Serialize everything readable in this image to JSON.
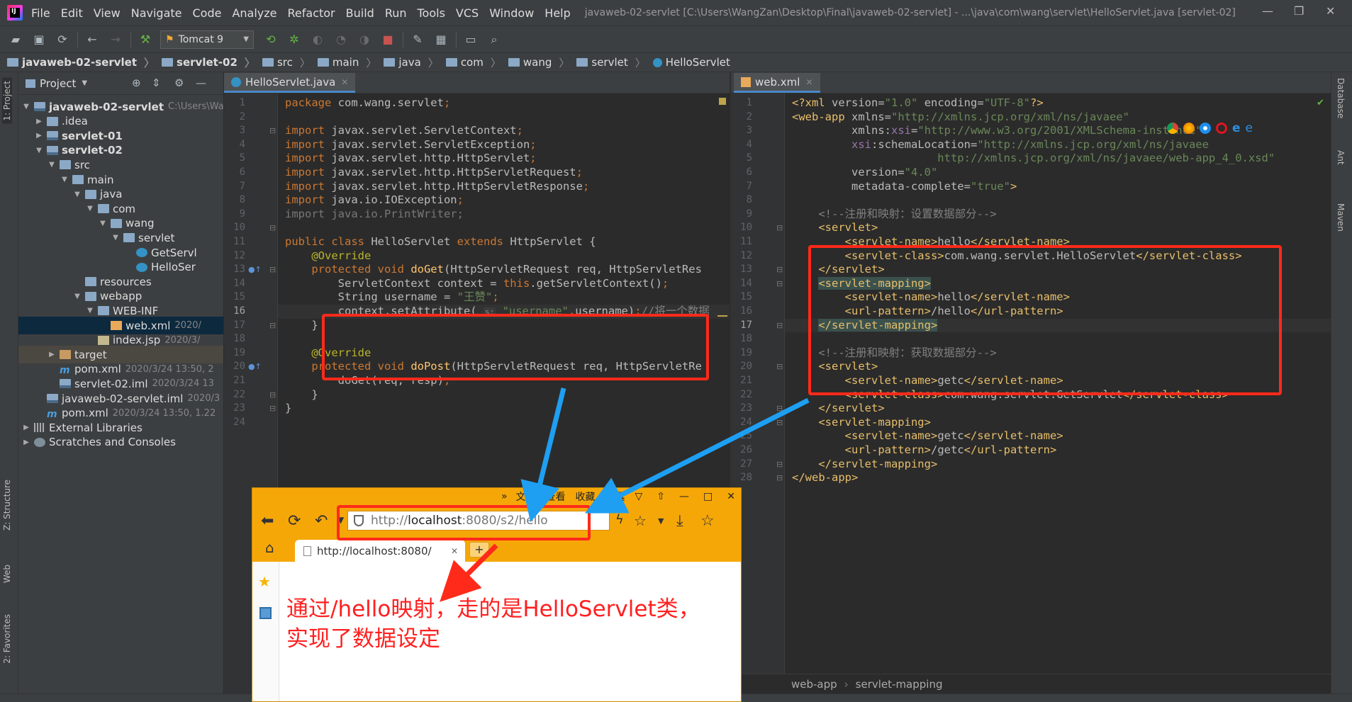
{
  "app": {
    "menu": [
      "File",
      "Edit",
      "View",
      "Navigate",
      "Code",
      "Analyze",
      "Refactor",
      "Build",
      "Run",
      "Tools",
      "VCS",
      "Window",
      "Help"
    ],
    "window_title": "javaweb-02-servlet [C:\\Users\\WangZan\\Desktop\\Final\\javaweb-02-servlet] - ...\\java\\com\\wang\\servlet\\HelloServlet.java [servlet-02]"
  },
  "toolbar": {
    "run_config": "Tomcat 9"
  },
  "breadcrumb": [
    "javaweb-02-servlet",
    "servlet-02",
    "src",
    "main",
    "java",
    "com",
    "wang",
    "servlet",
    "HelloServlet"
  ],
  "left_strip": {
    "project_tab": "1: Project",
    "structure_tab": "Z: Structure",
    "web_tab": "Web",
    "favorites_tab": "2: Favorites"
  },
  "project": {
    "title": "Project",
    "tree": [
      {
        "label": "javaweb-02-servlet",
        "meta": "C:\\Users\\Wa",
        "depth": 0,
        "arrow": "▼",
        "icon": "module",
        "bold": true
      },
      {
        "label": ".idea",
        "meta": "",
        "depth": 1,
        "arrow": "▶",
        "icon": "folder"
      },
      {
        "label": "servlet-01",
        "meta": "",
        "depth": 1,
        "arrow": "▶",
        "icon": "module",
        "bold": true
      },
      {
        "label": "servlet-02",
        "meta": "",
        "depth": 1,
        "arrow": "▼",
        "icon": "module",
        "bold": true
      },
      {
        "label": "src",
        "meta": "",
        "depth": 2,
        "arrow": "▼",
        "icon": "folder"
      },
      {
        "label": "main",
        "meta": "",
        "depth": 3,
        "arrow": "▼",
        "icon": "folder"
      },
      {
        "label": "java",
        "meta": "",
        "depth": 4,
        "arrow": "▼",
        "icon": "folder"
      },
      {
        "label": "com",
        "meta": "",
        "depth": 5,
        "arrow": "▼",
        "icon": "folder"
      },
      {
        "label": "wang",
        "meta": "",
        "depth": 6,
        "arrow": "▼",
        "icon": "folder"
      },
      {
        "label": "servlet",
        "meta": "",
        "depth": 7,
        "arrow": "▼",
        "icon": "folder"
      },
      {
        "label": "GetServl",
        "meta": "",
        "depth": 8,
        "arrow": "",
        "icon": "java"
      },
      {
        "label": "HelloSer",
        "meta": "",
        "depth": 8,
        "arrow": "",
        "icon": "java"
      },
      {
        "label": "resources",
        "meta": "",
        "depth": 4,
        "arrow": "",
        "icon": "folder"
      },
      {
        "label": "webapp",
        "meta": "",
        "depth": 4,
        "arrow": "▼",
        "icon": "folder"
      },
      {
        "label": "WEB-INF",
        "meta": "",
        "depth": 5,
        "arrow": "▼",
        "icon": "folder"
      },
      {
        "label": "web.xml",
        "meta": "2020/",
        "depth": 6,
        "arrow": "",
        "icon": "xml",
        "selected": true
      },
      {
        "label": "index.jsp",
        "meta": "2020/3/",
        "depth": 5,
        "arrow": "",
        "icon": "jsp"
      },
      {
        "label": "target",
        "meta": "",
        "depth": 2,
        "arrow": "▶",
        "icon": "target",
        "highlight": true
      },
      {
        "label": "pom.xml",
        "meta": "2020/3/24 13:50, 2",
        "depth": 2,
        "arrow": "",
        "icon": "m"
      },
      {
        "label": "servlet-02.iml",
        "meta": "2020/3/24 13",
        "depth": 2,
        "arrow": "",
        "icon": "module"
      },
      {
        "label": "javaweb-02-servlet.iml",
        "meta": "2020/3",
        "depth": 1,
        "arrow": "",
        "icon": "module"
      },
      {
        "label": "pom.xml",
        "meta": "2020/3/24 13:50, 1.22",
        "depth": 1,
        "arrow": "",
        "icon": "m"
      },
      {
        "label": "External Libraries",
        "meta": "",
        "depth": 0,
        "arrow": "▶",
        "icon": "lib"
      },
      {
        "label": "Scratches and Consoles",
        "meta": "",
        "depth": 0,
        "arrow": "▶",
        "icon": "scratch"
      }
    ]
  },
  "java_editor": {
    "tab": "HelloServlet.java",
    "current_line": 16,
    "lines": [
      [
        [
          "kw",
          "package "
        ],
        [
          "p",
          "com.wang.servlet"
        ],
        [
          "kw",
          ";"
        ]
      ],
      [],
      [
        [
          "kw",
          "import "
        ],
        [
          "p",
          "javax.servlet.ServletContext"
        ],
        [
          "kw",
          ";"
        ]
      ],
      [
        [
          "kw",
          "import "
        ],
        [
          "p",
          "javax.servlet.ServletException"
        ],
        [
          "kw",
          ";"
        ]
      ],
      [
        [
          "kw",
          "import "
        ],
        [
          "p",
          "javax.servlet.http.HttpServlet"
        ],
        [
          "kw",
          ";"
        ]
      ],
      [
        [
          "kw",
          "import "
        ],
        [
          "p",
          "javax.servlet.http.HttpServletRequest"
        ],
        [
          "kw",
          ";"
        ]
      ],
      [
        [
          "kw",
          "import "
        ],
        [
          "p",
          "javax.servlet.http.HttpServletResponse"
        ],
        [
          "kw",
          ";"
        ]
      ],
      [
        [
          "kw",
          "import "
        ],
        [
          "p",
          "java.io.IOException"
        ],
        [
          "kw",
          ";"
        ]
      ],
      [
        [
          "dim",
          "import java.io.PrintWriter;"
        ]
      ],
      [],
      [
        [
          "kw",
          "public class "
        ],
        [
          "p",
          "HelloServlet "
        ],
        [
          "kw",
          "extends "
        ],
        [
          "p",
          "HttpServlet {"
        ]
      ],
      [
        [
          "p",
          "    "
        ],
        [
          "ann",
          "@Override"
        ]
      ],
      [
        [
          "p",
          "    "
        ],
        [
          "kw",
          "protected void "
        ],
        [
          "fn",
          "doGet"
        ],
        [
          "p",
          "(HttpServletRequest req, HttpServletRes"
        ]
      ],
      [
        [
          "p",
          "        ServletContext context = "
        ],
        [
          "kw",
          "this"
        ],
        [
          "p",
          ".getServletContext()"
        ],
        [
          "kw",
          ";"
        ]
      ],
      [
        [
          "p",
          "        String username = "
        ],
        [
          "str",
          "\"王赞\""
        ],
        [
          "kw",
          ";"
        ]
      ],
      [
        [
          "p",
          "        context.setAttribute( "
        ],
        [
          "hint",
          "s:"
        ],
        [
          "p",
          " "
        ],
        [
          "str",
          "\"username\""
        ],
        [
          "kw",
          ","
        ],
        [
          "p",
          "username)"
        ],
        [
          "kw",
          ";"
        ],
        [
          "com",
          "//将一个数据"
        ]
      ],
      [
        [
          "p",
          "    }"
        ]
      ],
      [],
      [
        [
          "p",
          "    "
        ],
        [
          "ann",
          "@Override"
        ]
      ],
      [
        [
          "p",
          "    "
        ],
        [
          "kw",
          "protected void "
        ],
        [
          "fn",
          "doPost"
        ],
        [
          "p",
          "(HttpServletRequest req, HttpServletRe"
        ]
      ],
      [
        [
          "p",
          "        doGet(req, resp)"
        ],
        [
          "kw",
          ";"
        ]
      ],
      [
        [
          "p",
          "    }"
        ]
      ],
      [
        [
          "p",
          "}"
        ]
      ],
      []
    ]
  },
  "xml_editor": {
    "tab": "web.xml",
    "current_line": 17,
    "lines": [
      [
        [
          "tag",
          "<?xml "
        ],
        [
          "attr",
          "version"
        ],
        [
          "p",
          "="
        ],
        [
          "aval",
          "\"1.0\""
        ],
        [
          "p",
          " "
        ],
        [
          "attr",
          "encoding"
        ],
        [
          "p",
          "="
        ],
        [
          "aval",
          "\"UTF-8\""
        ],
        [
          "tag",
          "?>"
        ]
      ],
      [
        [
          "tag",
          "<web-app "
        ],
        [
          "attr",
          "xmlns"
        ],
        [
          "p",
          "="
        ],
        [
          "aval",
          "\"http://xmlns.jcp.org/xml/ns/javaee\""
        ]
      ],
      [
        [
          "p",
          "         "
        ],
        [
          "attr",
          "xmlns"
        ],
        [
          "p",
          ":"
        ],
        [
          "ns",
          "xsi"
        ],
        [
          "p",
          "="
        ],
        [
          "aval",
          "\"http://www.w3.org/2001/XMLSchema-instance\""
        ]
      ],
      [
        [
          "p",
          "         "
        ],
        [
          "ns",
          "xsi"
        ],
        [
          "p",
          ":"
        ],
        [
          "attr",
          "schemaLocation"
        ],
        [
          "p",
          "="
        ],
        [
          "aval",
          "\"http://xmlns.jcp.org/xml/ns/javaee"
        ]
      ],
      [
        [
          "aval",
          "                      http://xmlns.jcp.org/xml/ns/javaee/web-app_4_0.xsd\""
        ]
      ],
      [
        [
          "p",
          "         "
        ],
        [
          "attr",
          "version"
        ],
        [
          "p",
          "="
        ],
        [
          "aval",
          "\"4.0\""
        ]
      ],
      [
        [
          "p",
          "         "
        ],
        [
          "attr",
          "metadata-complete"
        ],
        [
          "p",
          "="
        ],
        [
          "aval",
          "\"true\""
        ],
        [
          "tag",
          ">"
        ]
      ],
      [],
      [
        [
          "p",
          "    "
        ],
        [
          "com",
          "<!--注册和映射：设置数据部分-->"
        ]
      ],
      [
        [
          "p",
          "    "
        ],
        [
          "tag",
          "<servlet>"
        ]
      ],
      [
        [
          "p",
          "        "
        ],
        [
          "tag",
          "<servlet-name>"
        ],
        [
          "p",
          "hello"
        ],
        [
          "tag",
          "</servlet-name>"
        ]
      ],
      [
        [
          "p",
          "        "
        ],
        [
          "tag",
          "<servlet-class>"
        ],
        [
          "p",
          "com.wang.servlet.HelloServlet"
        ],
        [
          "tag",
          "</servlet-class>"
        ]
      ],
      [
        [
          "p",
          "    "
        ],
        [
          "tag",
          "</servlet>"
        ]
      ],
      [
        [
          "p",
          "    "
        ],
        [
          "taghl",
          "<servlet-mapping>"
        ]
      ],
      [
        [
          "p",
          "        "
        ],
        [
          "tag",
          "<servlet-name>"
        ],
        [
          "p",
          "hello"
        ],
        [
          "tag",
          "</servlet-name>"
        ]
      ],
      [
        [
          "p",
          "        "
        ],
        [
          "tag",
          "<url-pattern>"
        ],
        [
          "p",
          "/hello"
        ],
        [
          "tag",
          "</url-pattern>"
        ]
      ],
      [
        [
          "p",
          "    "
        ],
        [
          "taghl",
          "</servlet-mapping>"
        ]
      ],
      [],
      [
        [
          "p",
          "    "
        ],
        [
          "com",
          "<!--注册和映射：获取数据部分-->"
        ]
      ],
      [
        [
          "p",
          "    "
        ],
        [
          "tag",
          "<servlet>"
        ]
      ],
      [
        [
          "p",
          "        "
        ],
        [
          "tag",
          "<servlet-name>"
        ],
        [
          "p",
          "getc"
        ],
        [
          "tag",
          "</servlet-name>"
        ]
      ],
      [
        [
          "p",
          "        "
        ],
        [
          "tag",
          "<servlet-class>"
        ],
        [
          "p",
          "com.wang.servlet.GetServlet"
        ],
        [
          "tag",
          "</servlet-class>"
        ]
      ],
      [
        [
          "p",
          "    "
        ],
        [
          "tag",
          "</servlet>"
        ]
      ],
      [
        [
          "p",
          "    "
        ],
        [
          "tag",
          "<servlet-mapping>"
        ]
      ],
      [
        [
          "p",
          "        "
        ],
        [
          "tag",
          "<servlet-name>"
        ],
        [
          "p",
          "getc"
        ],
        [
          "tag",
          "</servlet-name>"
        ]
      ],
      [
        [
          "p",
          "        "
        ],
        [
          "tag",
          "<url-pattern>"
        ],
        [
          "p",
          "/getc"
        ],
        [
          "tag",
          "</url-pattern>"
        ]
      ],
      [
        [
          "p",
          "    "
        ],
        [
          "tag",
          "</servlet-mapping>"
        ]
      ],
      [
        [
          "tag",
          "</web-app>"
        ]
      ]
    ],
    "breadcrumb": [
      "web-app",
      "servlet-mapping"
    ]
  },
  "right_strip": {
    "database_tab": "Database",
    "ant_tab": "Ant",
    "maven_tab": "Maven"
  },
  "browser": {
    "menu": [
      "文件",
      "查看",
      "收藏",
      "工具"
    ],
    "address_prefix": "http://",
    "address_host": "localhost",
    "address_rest": ":8080/s2/hello",
    "tab_title": "http://localhost:8080/",
    "annotation_line1": "通过/hello映射，走的是HelloServlet类，",
    "annotation_line2": "实现了数据设定"
  },
  "colors": {
    "annotation_red": "#ff2a1a",
    "arrow_blue": "#1e9ff2",
    "browser_orange": "#f6a708"
  }
}
